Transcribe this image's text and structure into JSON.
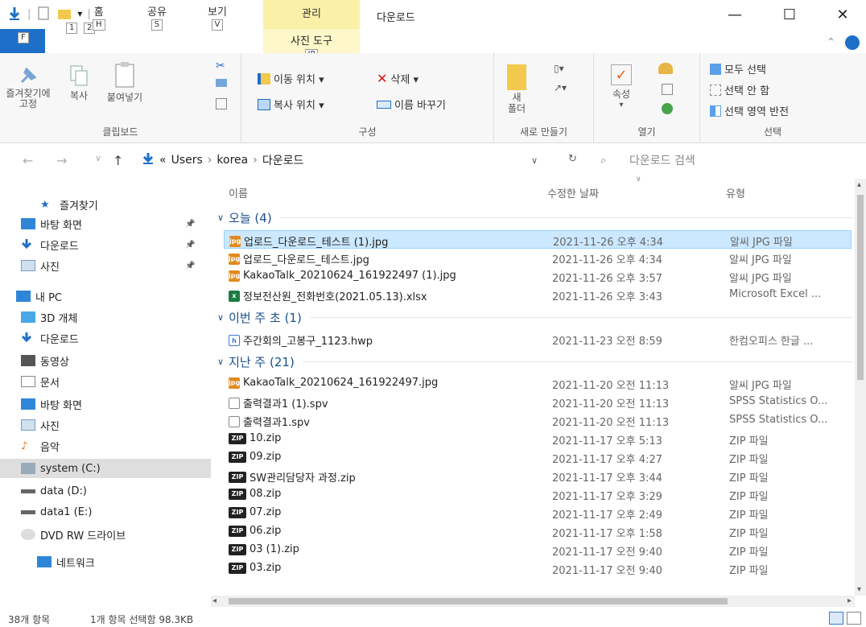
{
  "title_bar": {
    "manage_tab": "관리",
    "window_title": "다운로드",
    "quick_access_keytips": [
      "1",
      "2"
    ],
    "minimize": "—",
    "maximize": "☐",
    "close": "✕"
  },
  "ribbon_tabs": {
    "file_keytip": "F",
    "tabs": [
      {
        "label": "홈",
        "keytip": "H"
      },
      {
        "label": "공유",
        "keytip": "S"
      },
      {
        "label": "보기",
        "keytip": "V"
      }
    ],
    "photo_tools": {
      "label": "사진 도구",
      "keytip": "JP"
    }
  },
  "ribbon": {
    "clipboard": {
      "pin_label": "즐겨찾기에\n고정",
      "copy_label": "복사",
      "paste_label": "붙여넣기",
      "group_label": "클립보드"
    },
    "organize": {
      "move_to": "이동 위치 ▾",
      "copy_to": "복사 위치 ▾",
      "delete": "삭제 ▾",
      "rename": "이름 바꾸기",
      "group_label": "구성"
    },
    "new": {
      "new_folder": "새\n폴더",
      "group_label": "새로 만들기"
    },
    "open": {
      "properties": "속성",
      "group_label": "열기"
    },
    "select": {
      "select_all": "모두 선택",
      "select_none": "선택 안 함",
      "invert": "선택 영역 반전",
      "group_label": "선택"
    }
  },
  "address_bar": {
    "crumbs": [
      "«",
      "Users",
      "›",
      "korea",
      "›",
      "다운로드"
    ],
    "search_placeholder": "다운로드 검색"
  },
  "nav_pane": {
    "items": [
      {
        "label": "즐겨찾기",
        "icon": "star-icon",
        "pinned": false
      },
      {
        "label": "바탕 화면",
        "icon": "desktop-icon",
        "pinned": true
      },
      {
        "label": "다운로드",
        "icon": "download-icon",
        "pinned": true
      },
      {
        "label": "사진",
        "icon": "pictures-icon",
        "pinned": true
      },
      {
        "label": "내 PC",
        "icon": "pc-icon",
        "pinned": false
      },
      {
        "label": "3D 개체",
        "icon": "3d-objects-icon",
        "pinned": false
      },
      {
        "label": "다운로드",
        "icon": "download-icon",
        "pinned": false
      },
      {
        "label": "동영상",
        "icon": "videos-icon",
        "pinned": false
      },
      {
        "label": "문서",
        "icon": "documents-icon",
        "pinned": false
      },
      {
        "label": "바탕 화면",
        "icon": "desktop-icon",
        "pinned": false
      },
      {
        "label": "사진",
        "icon": "pictures-icon",
        "pinned": false
      },
      {
        "label": "음악",
        "icon": "music-icon",
        "pinned": false
      },
      {
        "label": "system (C:)",
        "icon": "drive-c-icon",
        "pinned": false,
        "selected": true
      },
      {
        "label": "data (D:)",
        "icon": "drive-icon",
        "pinned": false
      },
      {
        "label": "data1 (E:)",
        "icon": "drive-icon",
        "pinned": false
      },
      {
        "label": "DVD RW 드라이브",
        "icon": "dvd-icon",
        "pinned": false
      },
      {
        "label": "네트워크",
        "icon": "network-icon",
        "pinned": false
      }
    ]
  },
  "file_list": {
    "columns": {
      "name": "이름",
      "date": "수정한 날짜",
      "type": "유형"
    },
    "groups": [
      {
        "label": "오늘 (4)",
        "files": [
          {
            "name": "업로드_다운로드_테스트 (1).jpg",
            "date": "2021-11-26 오후 4:34",
            "type": "알씨 JPG 파일",
            "kind": "jpg",
            "selected": true
          },
          {
            "name": "업로드_다운로드_테스트.jpg",
            "date": "2021-11-26 오후 4:34",
            "type": "알씨 JPG 파일",
            "kind": "jpg"
          },
          {
            "name": "KakaoTalk_20210624_161922497 (1).jpg",
            "date": "2021-11-26 오후 3:57",
            "type": "알씨 JPG 파일",
            "kind": "jpg"
          },
          {
            "name": "정보전산원_전화번호(2021.05.13).xlsx",
            "date": "2021-11-26 오후 3:43",
            "type": "Microsoft Excel ...",
            "kind": "xlsx"
          }
        ]
      },
      {
        "label": "이번 주 초 (1)",
        "files": [
          {
            "name": "주간회의_고봉구_1123.hwp",
            "date": "2021-11-23 오전 8:59",
            "type": "한컴오피스 한글 ...",
            "kind": "hwp"
          }
        ]
      },
      {
        "label": "지난 주 (21)",
        "files": [
          {
            "name": "KakaoTalk_20210624_161922497.jpg",
            "date": "2021-11-20 오전 11:13",
            "type": "알씨 JPG 파일",
            "kind": "jpg"
          },
          {
            "name": "출력결과1 (1).spv",
            "date": "2021-11-20 오전 11:13",
            "type": "SPSS Statistics O...",
            "kind": "spv"
          },
          {
            "name": "출력결과1.spv",
            "date": "2021-11-20 오전 11:13",
            "type": "SPSS Statistics O...",
            "kind": "spv"
          },
          {
            "name": "10.zip",
            "date": "2021-11-17 오후 5:13",
            "type": "ZIP 파일",
            "kind": "zip"
          },
          {
            "name": "09.zip",
            "date": "2021-11-17 오후 4:27",
            "type": "ZIP 파일",
            "kind": "zip"
          },
          {
            "name": "SW관리담당자 과정.zip",
            "date": "2021-11-17 오후 3:44",
            "type": "ZIP 파일",
            "kind": "zip"
          },
          {
            "name": "08.zip",
            "date": "2021-11-17 오후 3:29",
            "type": "ZIP 파일",
            "kind": "zip"
          },
          {
            "name": "07.zip",
            "date": "2021-11-17 오후 2:49",
            "type": "ZIP 파일",
            "kind": "zip"
          },
          {
            "name": "06.zip",
            "date": "2021-11-17 오후 1:58",
            "type": "ZIP 파일",
            "kind": "zip"
          },
          {
            "name": "03 (1).zip",
            "date": "2021-11-17 오전 9:40",
            "type": "ZIP 파일",
            "kind": "zip"
          },
          {
            "name": "03.zip",
            "date": "2021-11-17 오전 9:40",
            "type": "ZIP 파일",
            "kind": "zip"
          }
        ]
      }
    ]
  },
  "status_bar": {
    "item_count": "38개 항목",
    "selection": "1개 항목 선택함 98.3KB"
  },
  "colors": {
    "accent": "#1e6fc8",
    "selection": "#cce8ff",
    "manage_tab": "#fbf0a8",
    "group_header": "#1a4f8b"
  }
}
